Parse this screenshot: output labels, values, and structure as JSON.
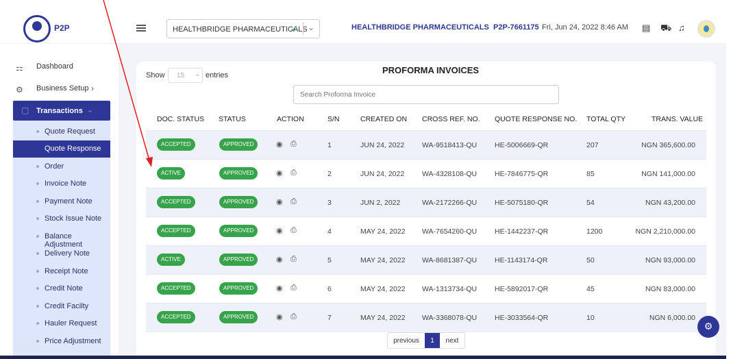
{
  "header": {
    "logo_text": "P2P",
    "org_select_value": "HEALTHBRIDGE PHARMACEUTICALS",
    "company_name": "HEALTHBRIDGE PHARMACEUTICALS",
    "user_id": "P2P-7661175",
    "datetime": "Fri, Jun 24, 2022 8:46 AM",
    "icons": [
      "hamburger-icon",
      "check-icon",
      "chevron-down-icon",
      "document-icon",
      "cart-icon",
      "bell-icon",
      "avatar"
    ]
  },
  "sidebar": {
    "dashboard": "Dashboard",
    "business_setup": "Business Setup",
    "transactions": "Transactions",
    "items": [
      {
        "label": "Quote Request"
      },
      {
        "label": "Quote Response"
      },
      {
        "label": "Order"
      },
      {
        "label": "Invoice Note"
      },
      {
        "label": "Payment Note"
      },
      {
        "label": "Stock Issue Note"
      },
      {
        "label": "Balance Adjustment"
      },
      {
        "label": "Delivery Note"
      },
      {
        "label": "Receipt Note"
      },
      {
        "label": "Credit Note"
      },
      {
        "label": "Credit Facilty"
      },
      {
        "label": "Hauler Request"
      },
      {
        "label": "Price Adjustment"
      }
    ],
    "active_item": "Quote Response"
  },
  "main": {
    "show_label": "Show",
    "entries_value": "15",
    "entries_label": "entries",
    "title": "PROFORMA INVOICES",
    "search_placeholder": "Search Proforma Invoice",
    "columns": [
      "DOC. STATUS",
      "STATUS",
      "ACTION",
      "S/N",
      "CREATED ON",
      "CROSS REF. NO.",
      "QUOTE RESPONSE NO.",
      "TOTAL QTY",
      "TRANS. VALUE"
    ],
    "rows": [
      {
        "doc_status": "ACCEPTED",
        "status": "APPROVED",
        "sn": "1",
        "created": "JUN 24, 2022",
        "cross_ref": "WA-9518413-QU",
        "quote_no": "HE-5006669-QR",
        "qty": "207",
        "value": "NGN 365,600.00"
      },
      {
        "doc_status": "ACTIVE",
        "status": "APPROVED",
        "sn": "2",
        "created": "JUN 24, 2022",
        "cross_ref": "WA-4328108-QU",
        "quote_no": "HE-7846775-QR",
        "qty": "85",
        "value": "NGN 141,000.00"
      },
      {
        "doc_status": "ACCEPTED",
        "status": "APPROVED",
        "sn": "3",
        "created": "JUN 2, 2022",
        "cross_ref": "WA-2172266-QU",
        "quote_no": "HE-5075180-QR",
        "qty": "54",
        "value": "NGN 43,200.00"
      },
      {
        "doc_status": "ACCEPTED",
        "status": "APPROVED",
        "sn": "4",
        "created": "MAY 24, 2022",
        "cross_ref": "WA-7654260-QU",
        "quote_no": "HE-1442237-QR",
        "qty": "1200",
        "value": "NGN 2,210,000.00"
      },
      {
        "doc_status": "ACTIVE",
        "status": "APPROVED",
        "sn": "5",
        "created": "MAY 24, 2022",
        "cross_ref": "WA-8681387-QU",
        "quote_no": "HE-1143174-QR",
        "qty": "50",
        "value": "NGN 93,000.00"
      },
      {
        "doc_status": "ACCEPTED",
        "status": "APPROVED",
        "sn": "6",
        "created": "MAY 24, 2022",
        "cross_ref": "WA-1313734-QU",
        "quote_no": "HE-5892017-QR",
        "qty": "45",
        "value": "NGN 83,000.00"
      },
      {
        "doc_status": "ACCEPTED",
        "status": "APPROVED",
        "sn": "7",
        "created": "MAY 24, 2022",
        "cross_ref": "WA-3368078-QU",
        "quote_no": "HE-3033564-QR",
        "qty": "10",
        "value": "NGN 6,000.00"
      }
    ],
    "pagination": {
      "previous": "previous",
      "current": "1",
      "next": "next"
    }
  },
  "colors": {
    "brand": "#2f3796",
    "badge_green": "#37a34a",
    "submenu_bg": "#dde6fb",
    "annotation_arrow": "#e02020"
  }
}
